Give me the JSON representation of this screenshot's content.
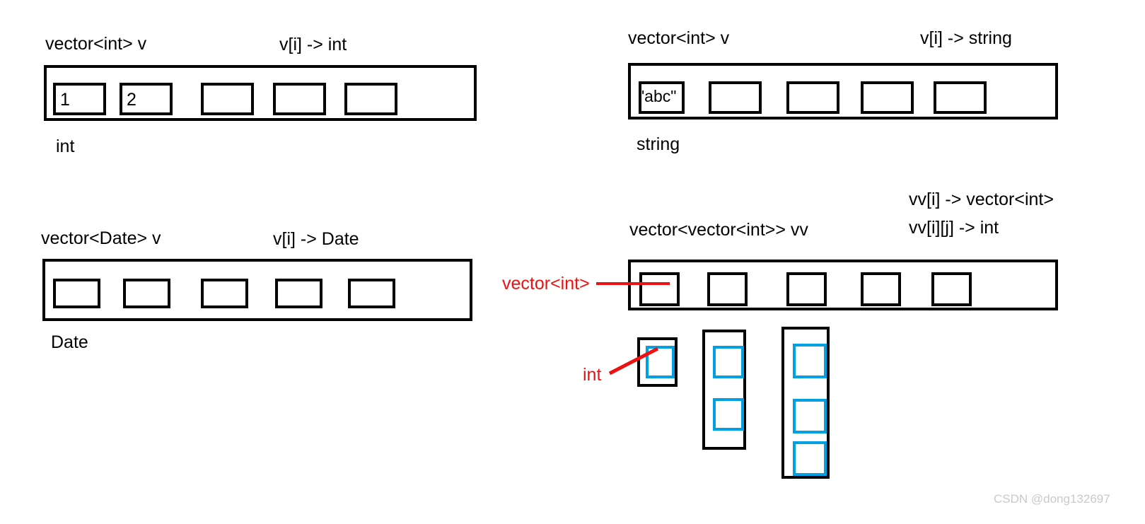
{
  "panels": {
    "top_left": {
      "type_label": "vector<int> v",
      "index_label": "v[i] -> int",
      "element_type_label": "int",
      "cells": [
        "1",
        "2",
        "",
        "",
        ""
      ]
    },
    "top_right": {
      "type_label": "vector<int> v",
      "index_label": "v[i] -> string",
      "element_type_label": "string",
      "cells": [
        "\"abc\"",
        "",
        "",
        "",
        ""
      ]
    },
    "bottom_left": {
      "type_label": "vector<Date> v",
      "index_label": "v[i] -> Date",
      "element_type_label": "Date",
      "cells": [
        "",
        "",
        "",
        "",
        ""
      ]
    },
    "bottom_right": {
      "type_label": "vector<vector<int>> vv",
      "index_label_1": "vv[i] -> vector<int>",
      "index_label_2": "vv[i][j] -> int",
      "callout_outer": "vector<int>",
      "callout_inner": "int",
      "cells": [
        "",
        "",
        "",
        "",
        ""
      ],
      "inner_vectors": [
        {
          "cell_count": 1
        },
        {
          "cell_count": 2
        },
        {
          "cell_count": 3
        }
      ]
    }
  },
  "colors": {
    "stroke": "#000000",
    "accent_blue": "#00A0E3",
    "callout_red": "#EE1111",
    "watermark_gray": "#C9C9C9"
  },
  "watermark": "CSDN @dong132697"
}
